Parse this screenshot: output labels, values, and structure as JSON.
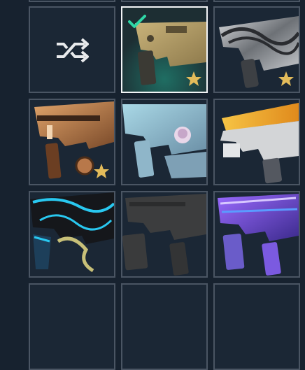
{
  "page": {
    "background": "#17222f"
  },
  "icons": {
    "shuffle": "shuffle-icon",
    "equipped": "checkmark-icon",
    "premium": "star-icon"
  },
  "colors": {
    "equipped_accent": "#2fd6a6",
    "star": "#e3bb5a",
    "tile_border": "#4a5563",
    "selected_border": "#f2f4f6"
  },
  "skins": [
    {
      "id": "random",
      "kind": "random",
      "equipped": false,
      "premium": false
    },
    {
      "id": "s1",
      "kind": "weapon",
      "style": "gold",
      "equipped": true,
      "premium": true
    },
    {
      "id": "s2",
      "kind": "weapon",
      "style": "silver",
      "equipped": false,
      "premium": true
    },
    {
      "id": "s3",
      "kind": "weapon",
      "style": "copper",
      "equipped": false,
      "premium": true
    },
    {
      "id": "s4",
      "kind": "weapon",
      "style": "anime",
      "equipped": false,
      "premium": false
    },
    {
      "id": "s5",
      "kind": "weapon",
      "style": "yellow",
      "equipped": false,
      "premium": false
    },
    {
      "id": "s6",
      "kind": "weapon",
      "style": "dragon",
      "equipped": false,
      "premium": false
    },
    {
      "id": "s7",
      "kind": "weapon",
      "style": "black",
      "equipped": false,
      "premium": false
    },
    {
      "id": "s8",
      "kind": "weapon",
      "style": "purple",
      "equipped": false,
      "premium": false
    }
  ]
}
